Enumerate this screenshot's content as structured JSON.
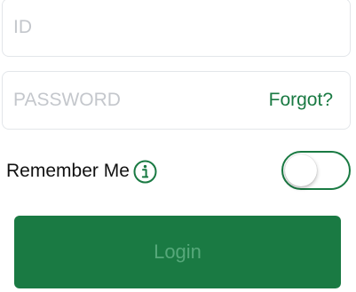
{
  "login_form": {
    "id_field": {
      "placeholder": "ID",
      "value": ""
    },
    "password_field": {
      "placeholder": "PASSWORD",
      "value": ""
    },
    "forgot_label": "Forgot?",
    "remember_me": {
      "label": "Remember Me",
      "toggle_on": false
    },
    "login_label": "Login"
  },
  "icons": {
    "info": "info-icon"
  },
  "colors": {
    "accent": "#1a7a43",
    "login_text": "#56a87a",
    "placeholder": "#c4c7cc",
    "border": "#e3e6ea"
  }
}
